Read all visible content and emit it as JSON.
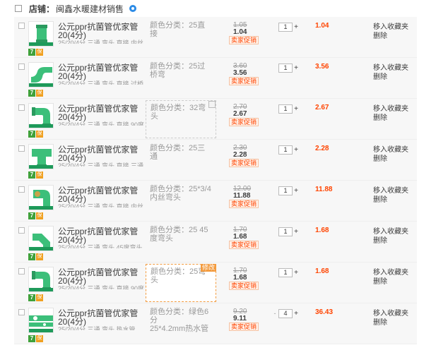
{
  "shop": {
    "prefix": "店铺：",
    "name": "闽鑫水暖建材销售"
  },
  "items": [
    {
      "title1": "公元ppr抗菌管优家管20(4分)",
      "title2": "25/20/4分 三通 弯头 直接 内丝",
      "spec_label": "颜色分类：",
      "spec": "25直接",
      "orig_price": "1.05",
      "price": "1.04",
      "promo": "卖家促销",
      "qty": "1",
      "subtotal": "1.04",
      "fav": "移入收藏夹",
      "del": "删除",
      "shape": "straight"
    },
    {
      "title1": "公元ppr抗菌管优家管20(4分)",
      "title2": "25/20/4分 三通 弯头 直接 过桥",
      "spec_label": "颜色分类：",
      "spec": "25过桥弯",
      "orig_price": "3.60",
      "price": "3.56",
      "promo": "卖家促销",
      "qty": "1",
      "subtotal": "3.56",
      "fav": "移入收藏夹",
      "del": "删除",
      "shape": "bridge"
    },
    {
      "title1": "公元ppr抗菌管优家管20(4分)",
      "title2": "25/20/4分 三通 弯头 直接 90度",
      "spec_label": "颜色分类：",
      "spec": "32弯头",
      "orig_price": "2.70",
      "price": "2.67",
      "promo": "卖家促销",
      "qty": "1",
      "subtotal": "2.67",
      "fav": "移入收藏夹",
      "del": "删除",
      "shape": "elbow"
    },
    {
      "title1": "公元ppr抗菌管优家管20(4分)",
      "title2": "25/20/4分 三通 弯头 直接 三通",
      "spec_label": "颜色分类：",
      "spec": "25三通",
      "orig_price": "2.30",
      "price": "2.28",
      "promo": "卖家促销",
      "qty": "1",
      "subtotal": "2.28",
      "fav": "移入收藏夹",
      "del": "删除",
      "shape": "tee"
    },
    {
      "title1": "公元ppr抗菌管优家管20(4分)",
      "title2": "25/20/4分 三通 弯头 直接 内丝",
      "spec_label": "颜色分类：",
      "spec": "25*3/4内丝弯头",
      "orig_price": "12.00",
      "price": "11.88",
      "promo": "卖家促销",
      "qty": "1",
      "subtotal": "11.88",
      "fav": "移入收藏夹",
      "del": "删除",
      "shape": "threaded"
    },
    {
      "title1": "公元ppr抗菌管优家管20(4分)",
      "title2": "25/20/4分 三通 弯头 45度弯头",
      "spec_label": "颜色分类：",
      "spec": "25 45度弯头",
      "orig_price": "1.70",
      "price": "1.68",
      "promo": "卖家促销",
      "qty": "1",
      "subtotal": "1.68",
      "fav": "移入收藏夹",
      "del": "删除",
      "shape": "elbow45"
    },
    {
      "title1": "公元ppr抗菌管优家管20(4分)",
      "title2": "25/20/4分 三通 弯头 直接 90度",
      "spec_label": "颜色分类：",
      "spec": "25弯头",
      "orig_price": "1.70",
      "price": "1.68",
      "promo": "卖家促销",
      "qty": "1",
      "subtotal": "1.68",
      "fav": "移入收藏夹",
      "del": "删除",
      "shape": "elbow",
      "edit_tag": "修改"
    },
    {
      "title1": "公元ppr抗菌管优家管20(4分)",
      "title2": "25/20/4分 三通 弯头 热水管",
      "spec_label": "颜色分类：",
      "spec": "绿色6分",
      "spec2": "25*4.2mm热水管",
      "orig_price": "9.20",
      "price": "9.11",
      "promo": "卖家促销",
      "qty": "4",
      "subtotal": "36.43",
      "fav": "移入收藏夹",
      "del": "删除",
      "shape": "pipe",
      "minus": "-"
    }
  ],
  "colors": {
    "accent": "#ff4400",
    "pipe_green": "#3cbf7a"
  }
}
